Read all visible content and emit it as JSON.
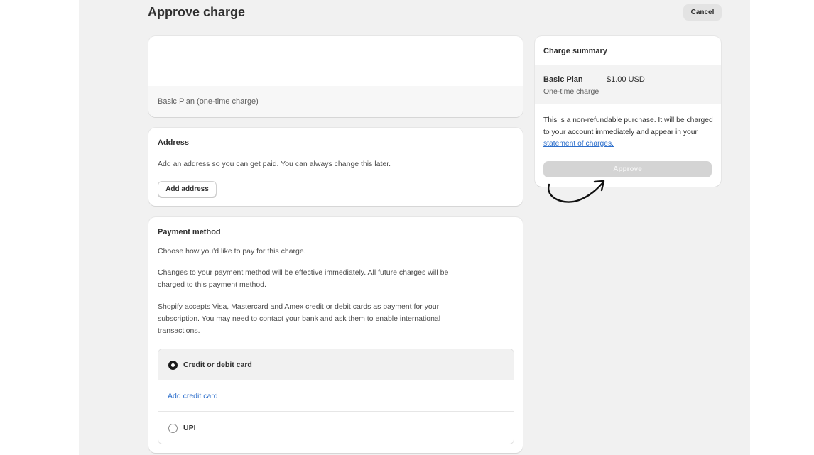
{
  "page": {
    "title": "Approve charge",
    "cancel_label": "Cancel"
  },
  "plan_card": {
    "label": "Basic Plan (one-time charge)"
  },
  "address": {
    "title": "Address",
    "description": "Add an address so you can get paid. You can always change this later.",
    "button_label": "Add address"
  },
  "payment": {
    "title": "Payment method",
    "paragraph1": "Choose how you'd like to pay for this charge.",
    "paragraph2_line1": "Changes to your payment method will be effective immediately. All future charges will be",
    "paragraph2_line2": "charged to this payment method.",
    "paragraph3_line1": "Shopify accepts Visa, Mastercard and Amex credit or debit cards as payment for your",
    "paragraph3_line2": "subscription. You may need to contact your bank and ask them to enable international",
    "paragraph3_line3": "transactions.",
    "options": [
      {
        "label": "Credit or debit card",
        "selected": true
      },
      {
        "label": "UPI",
        "selected": false
      }
    ],
    "add_card_link": "Add credit card"
  },
  "summary": {
    "title": "Charge summary",
    "plan_name": "Basic Plan",
    "plan_price": "$1.00 USD",
    "plan_type": "One-time charge",
    "notice": "This is a non-refundable purchase. It will be charged to your account immediately and appear in your ",
    "notice_link": "statement of charges.",
    "approve_label": "Approve"
  },
  "icons": {
    "selected_radio": "radio-selected-icon",
    "unselected_radio": "radio-unselected-icon",
    "annotation_arrow": "curved-arrow-icon"
  },
  "colors": {
    "link": "#2c6ecb",
    "approve_disabled": "#d4d4d4",
    "page_background": "#f1f1f1"
  }
}
